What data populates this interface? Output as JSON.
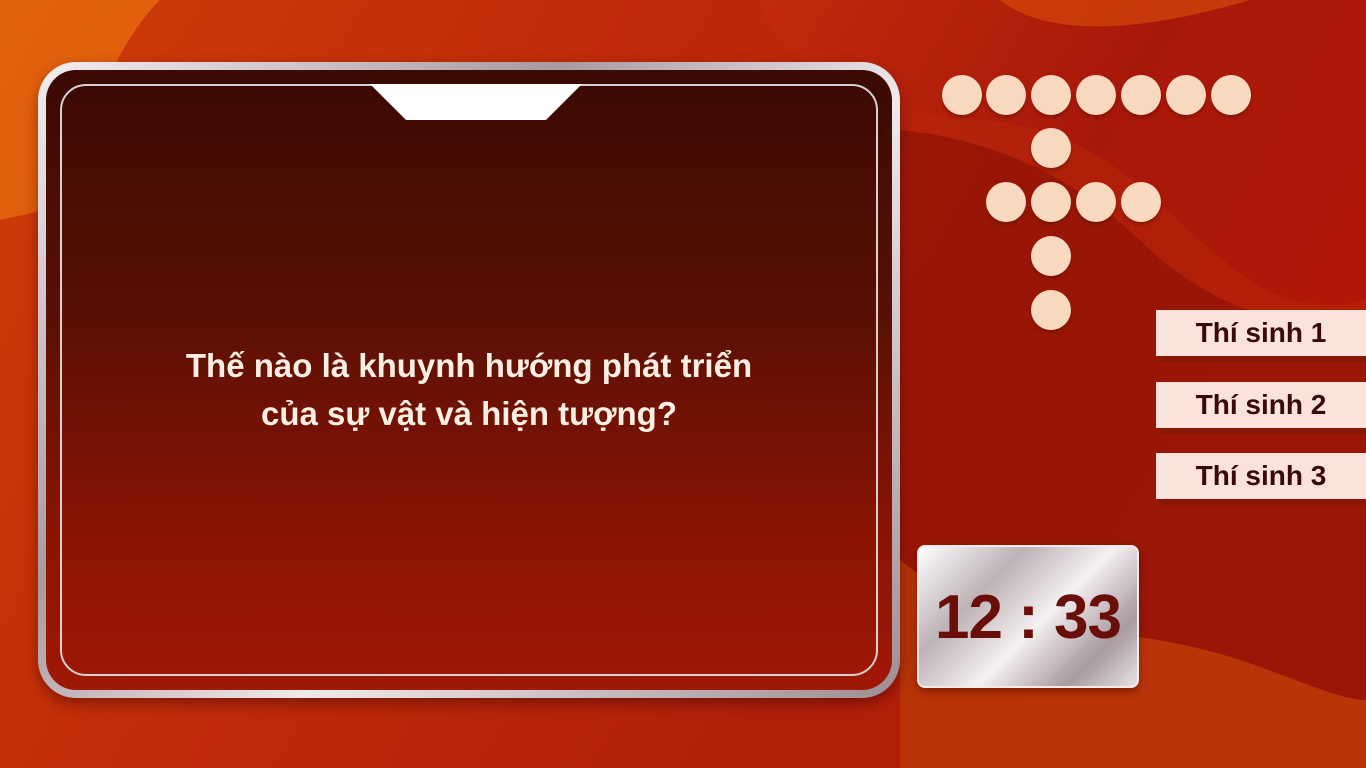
{
  "question": {
    "line1": "Thế nào là khuynh hướng phát triển",
    "line2": "của sự vật và hiện tượng?"
  },
  "players": [
    {
      "label": "Thí sinh 1"
    },
    {
      "label": "Thí sinh 2"
    },
    {
      "label": "Thí sinh 3"
    }
  ],
  "timer": {
    "value": "12 : 33"
  },
  "dot_color": "#f8d8bf",
  "accent_dark": "#6a0e0a"
}
